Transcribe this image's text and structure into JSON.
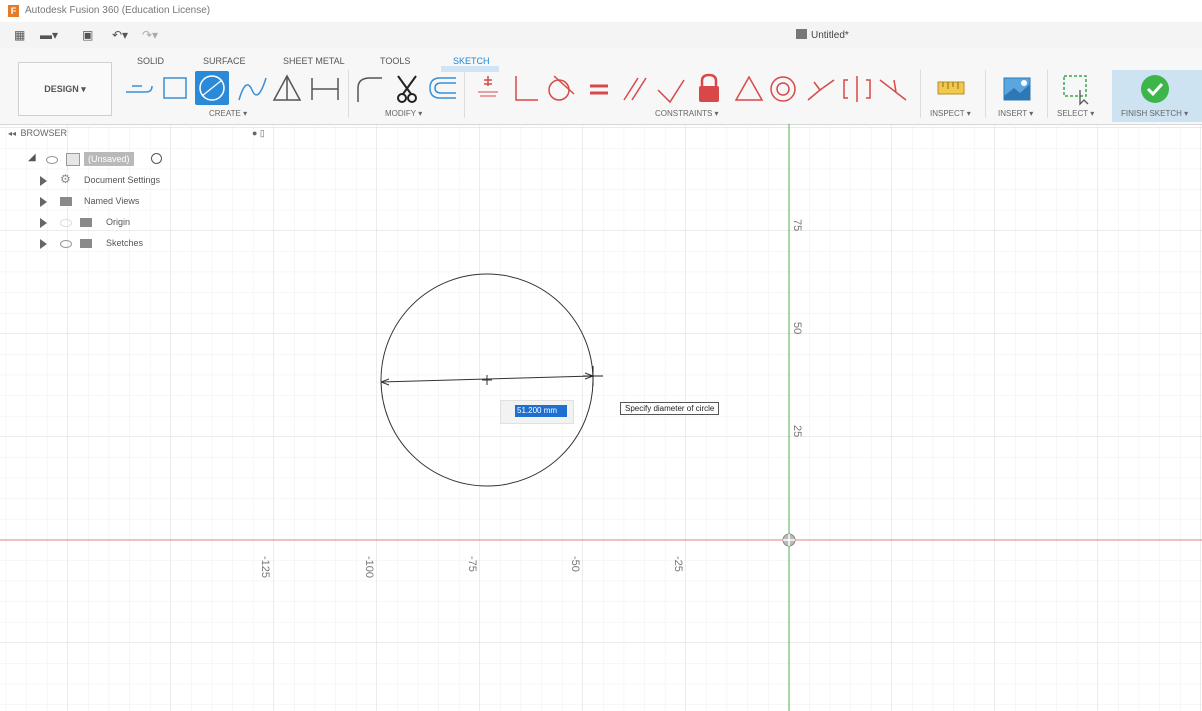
{
  "window": {
    "title": "Autodesk Fusion 360 (Education License)"
  },
  "document": {
    "title": "Untitled*"
  },
  "ribbon": {
    "workspace": "DESIGN ▾",
    "tabs": [
      {
        "label": "SOLID"
      },
      {
        "label": "SURFACE"
      },
      {
        "label": "SHEET METAL"
      },
      {
        "label": "TOOLS"
      },
      {
        "label": "SKETCH"
      }
    ],
    "groups": {
      "create": "CREATE ▾",
      "modify": "MODIFY ▾",
      "constraints": "CONSTRAINTS ▾",
      "inspect": "INSPECT ▾",
      "insert": "INSERT ▾",
      "select": "SELECT ▾",
      "finish": "FINISH SKETCH ▾"
    }
  },
  "browser": {
    "header": "BROWSER",
    "root": "(Unsaved)",
    "items": [
      {
        "label": "Document Settings"
      },
      {
        "label": "Named Views"
      },
      {
        "label": "Origin"
      },
      {
        "label": "Sketches"
      }
    ]
  },
  "canvas": {
    "x_ticks": [
      "-125",
      "-100",
      "-75",
      "-50",
      "-25"
    ],
    "y_ticks": [
      "75",
      "50",
      "25"
    ],
    "dimension_value": "51.200 mm",
    "tooltip": "Specify diameter of circle"
  },
  "colors": {
    "accent": "#1e88d2",
    "constraint_red": "#d94848",
    "finish_green": "#3cb54a",
    "axis_green": "#4caf50",
    "axis_red": "#e08080"
  }
}
